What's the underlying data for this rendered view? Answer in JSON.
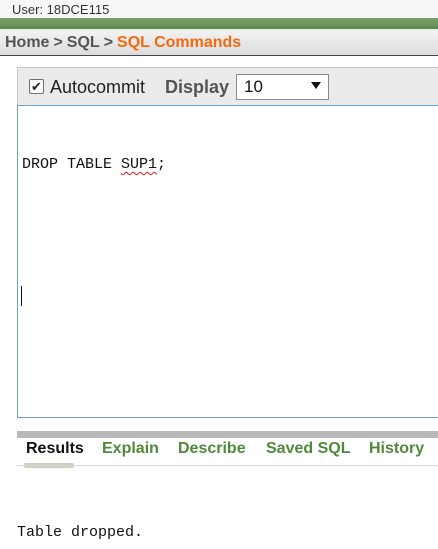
{
  "user": {
    "label": "User: 18DCE115"
  },
  "breadcrumb": {
    "home": "Home",
    "sep1": ">",
    "sql": "SQL",
    "sep2": ">",
    "current": "SQL Commands"
  },
  "toolbar": {
    "autocommit_label": "Autocommit",
    "autocommit_checked": true,
    "checkmark": "✔",
    "display_label": "Display",
    "display_value": "10"
  },
  "editor": {
    "sql_prefix": "DROP TABLE ",
    "sql_misspelled": "SUP1",
    "sql_suffix": ";"
  },
  "tabs": [
    {
      "label": "Results",
      "active": true
    },
    {
      "label": "Explain",
      "active": false
    },
    {
      "label": "Describe",
      "active": false
    },
    {
      "label": "Saved SQL",
      "active": false
    },
    {
      "label": "History",
      "active": false
    }
  ],
  "results": {
    "message": "Table dropped."
  },
  "colors": {
    "accent_orange": "#f06a0f",
    "tab_green": "#4f8a3b",
    "header_green": "#6b9a5c",
    "editor_border": "#6fa2c8"
  },
  "icons": {
    "dropdown": "chevron-down-icon",
    "checkbox": "checkmark-icon"
  }
}
